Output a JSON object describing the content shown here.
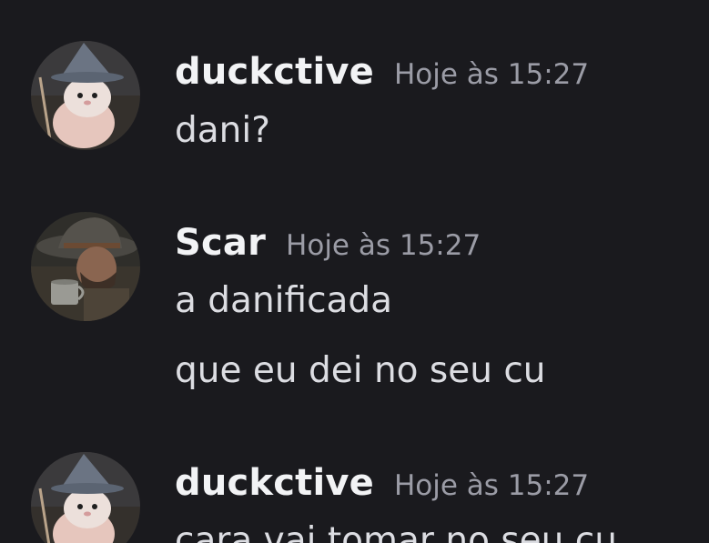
{
  "colors": {
    "background": "#1a1a1e",
    "username": "#f2f3f5",
    "timestamp": "#9b9ca6",
    "message_text": "#dcdde2"
  },
  "messages": [
    {
      "author": "duckctive",
      "timestamp": "Hoje às 15:27",
      "avatar_icon": "wizard-cat-avatar",
      "lines": [
        "dani?"
      ]
    },
    {
      "author": "Scar",
      "timestamp": "Hoje às 15:27",
      "avatar_icon": "cowboy-avatar",
      "lines": [
        "a danificada",
        "que eu dei no seu cu"
      ]
    },
    {
      "author": "duckctive",
      "timestamp": "Hoje às 15:27",
      "avatar_icon": "wizard-cat-avatar",
      "lines": [
        "cara vai tomar no seu cu"
      ]
    }
  ]
}
